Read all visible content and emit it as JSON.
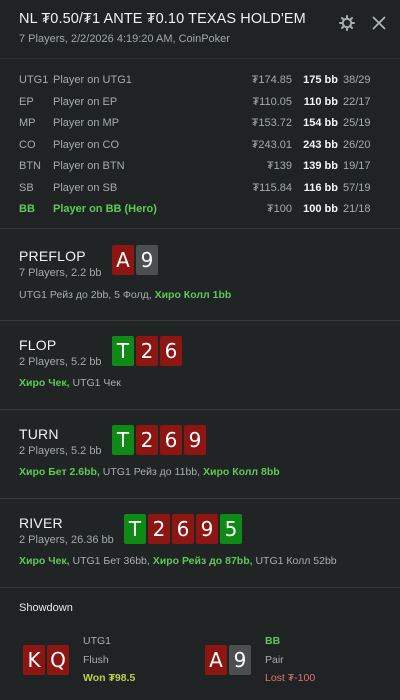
{
  "header": {
    "title": "NL ₮0.50/₮1 ANTE ₮0.10 TEXAS HOLD'EM",
    "subtitle": "7 Players, 2/2/2026 4:19:20 AM, CoinPoker",
    "icons": [
      "gear-icon",
      "close-icon"
    ]
  },
  "players": [
    {
      "pos": "UTG1",
      "name": "Player on UTG1",
      "money": "₮174.85",
      "bb": "175 bb",
      "hands": "38/29"
    },
    {
      "pos": "EP",
      "name": "Player on EP",
      "money": "₮110.05",
      "bb": "110 bb",
      "hands": "22/17"
    },
    {
      "pos": "MP",
      "name": "Player on MP",
      "money": "₮153.72",
      "bb": "154 bb",
      "hands": "25/19"
    },
    {
      "pos": "CO",
      "name": "Player on CO",
      "money": "₮243.01",
      "bb": "243 bb",
      "hands": "26/20"
    },
    {
      "pos": "BTN",
      "name": "Player on BTN",
      "money": "₮139",
      "bb": "139 bb",
      "hands": "19/17"
    },
    {
      "pos": "SB",
      "name": "Player on SB",
      "money": "₮115.84",
      "bb": "116 bb",
      "hands": "57/19"
    },
    {
      "pos": "BB",
      "name": "Player on BB (Hero)",
      "money": "₮100",
      "bb": "100 bb",
      "hands": "21/18"
    }
  ],
  "streets": {
    "preflop": {
      "name": "PREFLOP",
      "meta": "7 Players, 2.2 bb",
      "cards": [
        {
          "v": "A",
          "c": "red"
        },
        {
          "v": "9",
          "c": "gray"
        }
      ],
      "action_plain": "UTG1 Рейз до 2bb, 5 Фолд, ",
      "action_hero": "Хиро Колл 1bb"
    },
    "flop": {
      "name": "FLOP",
      "meta": "2 Players, 5.2 bb",
      "cards": [
        {
          "v": "T",
          "c": "green"
        },
        {
          "v": "2",
          "c": "red"
        },
        {
          "v": "6",
          "c": "red"
        }
      ],
      "action_hero": "Хиро Чек,",
      "action_plain": " UTG1 Чек"
    },
    "turn": {
      "name": "TURN",
      "meta": "2 Players, 5.2 bb",
      "cards": [
        {
          "v": "T",
          "c": "green"
        },
        {
          "v": "2",
          "c": "red"
        },
        {
          "v": "6",
          "c": "red"
        },
        {
          "v": "9",
          "c": "red"
        }
      ],
      "action_hero_1": "Хиро Бет 2.6bb,",
      "action_plain_1": " UTG1 Рейз до 11bb, ",
      "action_hero_2": "Хиро Колл 8bb"
    },
    "river": {
      "name": "RIVER",
      "meta": "2 Players, 26.36 bb",
      "cards": [
        {
          "v": "T",
          "c": "green"
        },
        {
          "v": "2",
          "c": "red"
        },
        {
          "v": "6",
          "c": "red"
        },
        {
          "v": "9",
          "c": "red"
        },
        {
          "v": "5",
          "c": "green"
        }
      ],
      "action_hero_1": "Хиро Чек,",
      "action_plain_1": " UTG1 Бет 36bb, ",
      "action_hero_2": "Хиро Рейз до 87bb,",
      "action_plain_2": " UTG1 Колл 52bb"
    }
  },
  "showdown": {
    "title": "Showdown",
    "left": {
      "cards": [
        {
          "v": "K",
          "c": "red"
        },
        {
          "v": "Q",
          "c": "red"
        }
      ],
      "player": "UTG1",
      "hand": "Flush",
      "result": "Won ₮98.5"
    },
    "right": {
      "cards": [
        {
          "v": "A",
          "c": "red"
        },
        {
          "v": "9",
          "c": "gray"
        }
      ],
      "player": "BB",
      "hand": "Pair",
      "result": "Lost ₮-100"
    }
  },
  "colors": {
    "hero": "#5ec957",
    "lost": "#e37373",
    "won": "#b7d24c",
    "card_red": "#8d1612",
    "card_green": "#108a17",
    "card_gray": "#4b4f50"
  }
}
